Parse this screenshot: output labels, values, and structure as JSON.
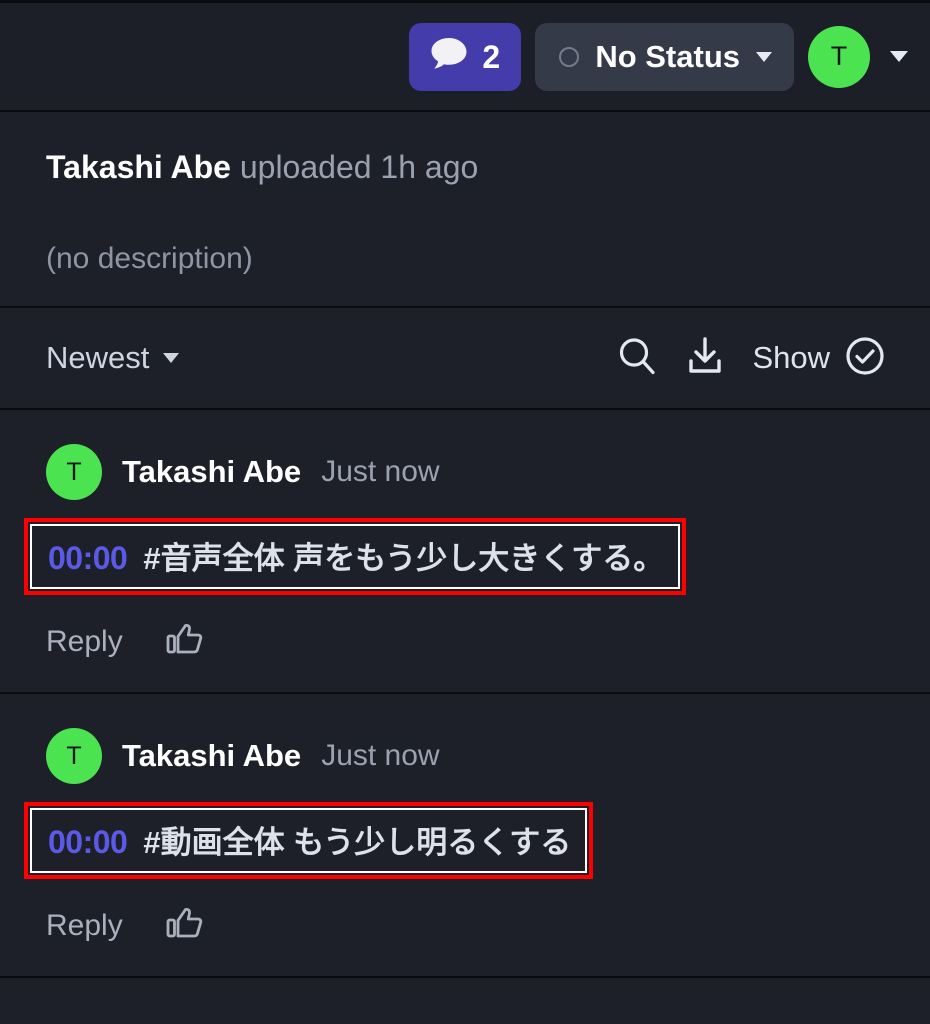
{
  "header": {
    "comment_badge": {
      "icon": "speech-bubble-icon",
      "count": "2",
      "color": "#453cab"
    },
    "status": {
      "icon": "status-circle-icon",
      "label": "No Status",
      "chevron": "chevron-down-icon",
      "color": "#343a47"
    },
    "avatar": {
      "initial": "T",
      "color": "#4ce350"
    },
    "account_chevron": "chevron-down-icon"
  },
  "upload": {
    "user": "Takashi Abe",
    "meta": "uploaded 1h ago",
    "description": "(no description)"
  },
  "toolbar": {
    "sort_label": "Newest",
    "sort_chevron": "chevron-down-icon",
    "search_icon": "search-icon",
    "download_icon": "download-icon",
    "show_label": "Show",
    "show_icon": "check-circle-icon"
  },
  "comments": [
    {
      "avatar_initial": "T",
      "avatar_color": "#4ce350",
      "name": "Takashi Abe",
      "time": "Just now",
      "timestamp": "00:00",
      "text": "#音声全体 声をもう少し大きくする。",
      "reply_label": "Reply",
      "like_icon": "thumbs-up-icon",
      "highlight_color": "#ff0000"
    },
    {
      "avatar_initial": "T",
      "avatar_color": "#4ce350",
      "name": "Takashi Abe",
      "time": "Just now",
      "timestamp": "00:00",
      "text": "#動画全体 もう少し明るくする",
      "reply_label": "Reply",
      "like_icon": "thumbs-up-icon",
      "highlight_color": "#ff0000"
    }
  ]
}
